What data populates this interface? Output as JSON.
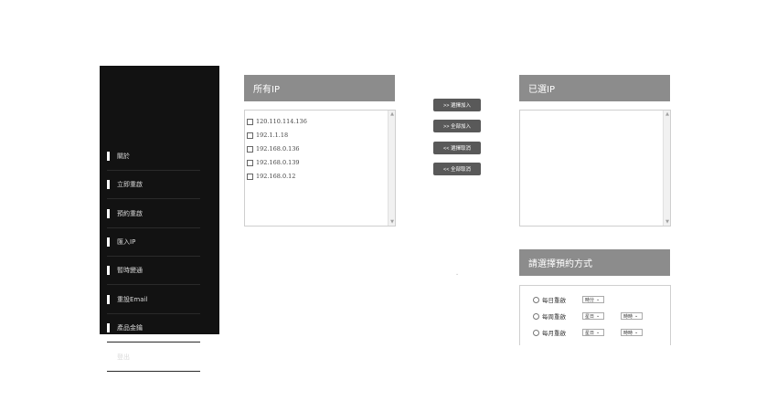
{
  "sidebar": {
    "items": [
      {
        "label": "關於"
      },
      {
        "label": "立即重啟"
      },
      {
        "label": "預約重啟"
      },
      {
        "label": "匯入IP"
      },
      {
        "label": "暫時變通"
      },
      {
        "label": "重設Email"
      },
      {
        "label": "產品金鑰"
      },
      {
        "label": "登出"
      }
    ]
  },
  "all_ip": {
    "title": "所有IP",
    "items": [
      "120.110.114.136",
      "192.1.1.18",
      "192.168.0.136",
      "192.168.0.139",
      "192.168.0.12"
    ]
  },
  "selected_ip": {
    "title": "已選IP"
  },
  "actions": {
    "add_selected": ">> 選擇加入",
    "add_all": ">> 全部加入",
    "remove_selected": "<< 選擇取消",
    "remove_all": "<< 全部取消"
  },
  "schedule": {
    "title": "請選擇預約方式",
    "daily": {
      "label": "每日重啟",
      "time": "時分"
    },
    "weekly": {
      "label": "每周重啟",
      "day": "星日",
      "time": "時時"
    },
    "monthly": {
      "label": "每月重啟",
      "day": "星日",
      "time": "時時"
    }
  }
}
